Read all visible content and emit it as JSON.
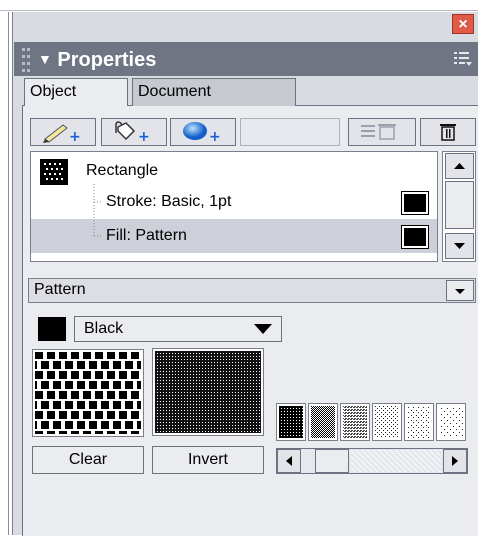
{
  "panel": {
    "title": "Properties",
    "close_glyph": "×"
  },
  "tabs": [
    {
      "label": "Object",
      "active": true
    },
    {
      "label": "Document",
      "active": false
    }
  ],
  "toolbar": {
    "buttons": [
      "pencil-plus-icon",
      "fill-bucket-plus-icon",
      "effect-sphere-plus-icon",
      "list-delete-icon",
      "trash-icon"
    ]
  },
  "attributes": {
    "object_name": "Rectangle",
    "stroke": "Stroke: Basic, 1pt",
    "fill": "Fill: Pattern",
    "stroke_color": "#000000",
    "fill_color": "#000000"
  },
  "fill_type": {
    "selected": "Pattern"
  },
  "color": {
    "selected": "Black",
    "swatch": "#000000"
  },
  "buttons": {
    "clear": "Clear",
    "invert": "Invert"
  },
  "colors": {
    "titlebar": "#6f7582",
    "selection": "#cdd0d8",
    "close": "#e05a48"
  }
}
